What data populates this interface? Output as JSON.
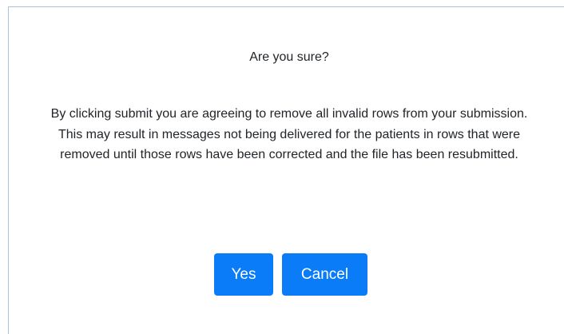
{
  "dialog": {
    "title": "Are you sure?",
    "message": "By clicking submit you are agreeing to remove all invalid rows from your submission. This may result in messages not being delivered for the patients in rows that were removed until those rows have been corrected and the file has been resubmitted.",
    "yes_label": "Yes",
    "cancel_label": "Cancel"
  },
  "colors": {
    "button": "#0a7cf7",
    "border": "#a7c4dc"
  }
}
